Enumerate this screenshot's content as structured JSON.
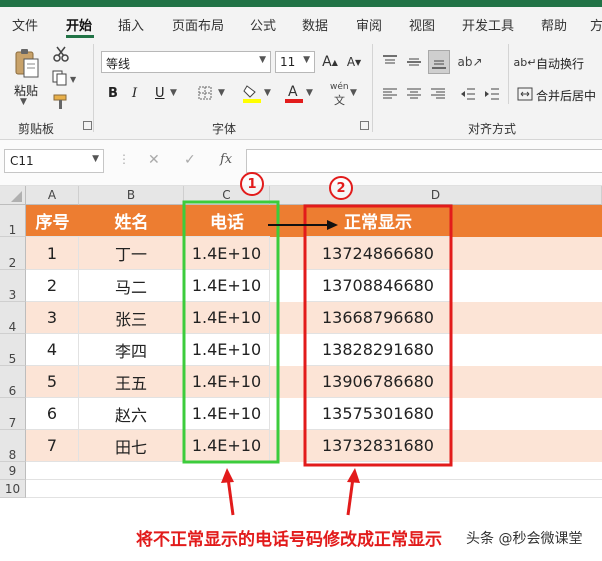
{
  "tabs": [
    "文件",
    "开始",
    "插入",
    "页面布局",
    "公式",
    "数据",
    "审阅",
    "视图",
    "开发工具",
    "帮助",
    "方"
  ],
  "active_tab": "开始",
  "clipboard": {
    "paste_label": "粘贴",
    "group_label": "剪贴板"
  },
  "font": {
    "name": "等线",
    "size": "11",
    "group_label": "字体",
    "bold": "B",
    "italic": "I",
    "underline": "U",
    "pinyin": "wén"
  },
  "alignment": {
    "wrap_label": "自动换行",
    "merge_label": "合并后居中",
    "group_label": "对齐方式"
  },
  "formula_bar": {
    "cell_ref": "C11",
    "fx": "fx",
    "cancel": "✕",
    "confirm": "✓"
  },
  "columns": [
    "A",
    "B",
    "C",
    "D"
  ],
  "rows": [
    "1",
    "2",
    "3",
    "4",
    "5",
    "6",
    "7",
    "8",
    "9",
    "10"
  ],
  "table": {
    "headers": [
      "序号",
      "姓名",
      "电话",
      "正常显示"
    ],
    "data": [
      [
        "1",
        "丁一",
        "1.4E+10",
        "13724866680"
      ],
      [
        "2",
        "马二",
        "1.4E+10",
        "13708846680"
      ],
      [
        "3",
        "张三",
        "1.4E+10",
        "13668796680"
      ],
      [
        "4",
        "李四",
        "1.4E+10",
        "13828291680"
      ],
      [
        "5",
        "王五",
        "1.4E+10",
        "13906786680"
      ],
      [
        "6",
        "赵六",
        "1.4E+10",
        "13575301680"
      ],
      [
        "7",
        "田七",
        "1.4E+10",
        "13732831680"
      ]
    ]
  },
  "annotations": {
    "marker_1": "1",
    "marker_2": "2",
    "caption": "将不正常显示的电话号码修改成正常显示",
    "watermark": "头条 @秒会微课堂"
  },
  "colors": {
    "header_fill": "#ed7d31",
    "stripe_fill": "#fce4d6",
    "excel_green": "#217346",
    "highlight_green": "#3ccc3c",
    "highlight_red": "#e21b1b"
  }
}
